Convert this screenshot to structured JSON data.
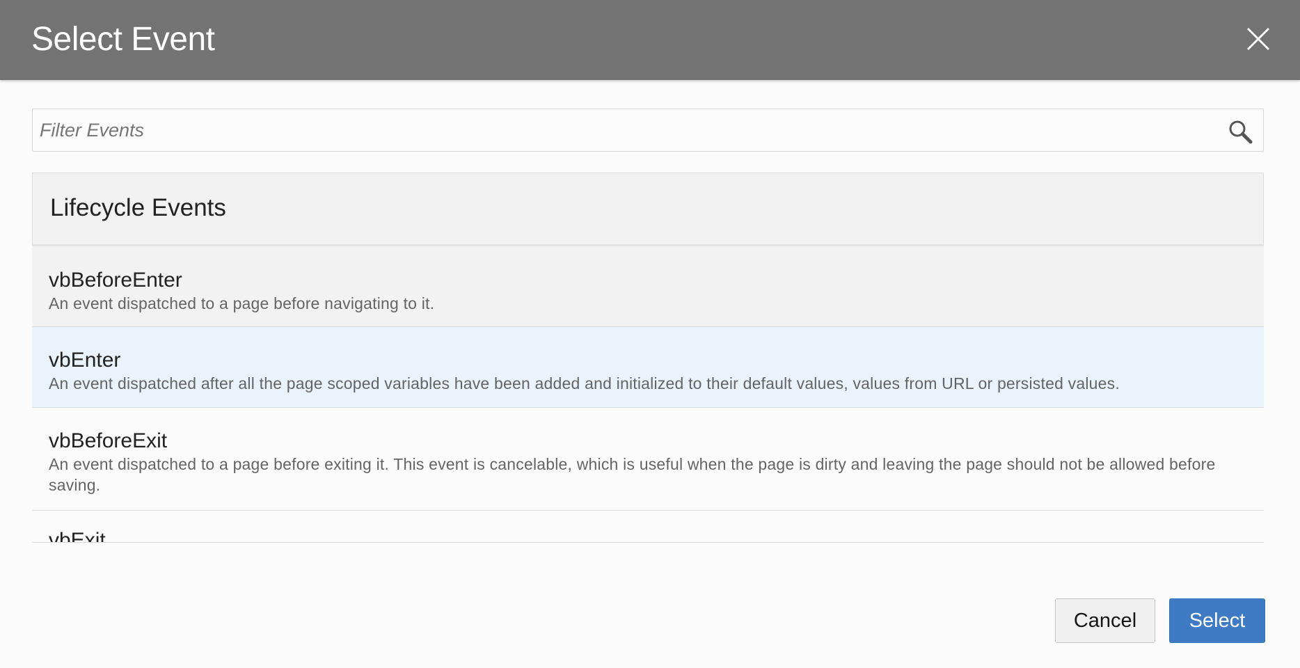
{
  "dialog": {
    "title": "Select Event",
    "close_icon": "close-icon"
  },
  "filter": {
    "placeholder": "Filter Events",
    "value": "",
    "icon": "search-icon"
  },
  "group": {
    "label": "Lifecycle Events"
  },
  "events": [
    {
      "name": "vbBeforeEnter",
      "description": "An event dispatched to a page before navigating to it."
    },
    {
      "name": "vbEnter",
      "description": "An event dispatched after all the page scoped variables have been added and initialized to their default values, values from URL or persisted values.",
      "selected": true
    },
    {
      "name": "vbBeforeExit",
      "description": "An event dispatched to a page before exiting it. This event is cancelable, which is useful when the page is dirty and leaving the page should not be allowed before saving."
    },
    {
      "name": "vbExit",
      "description": ""
    }
  ],
  "footer": {
    "cancel_label": "Cancel",
    "select_label": "Select"
  },
  "colors": {
    "header_bg": "#737373",
    "selected_row_bg": "#eaf2fb",
    "hover_row_bg": "#f2f2f2",
    "primary_button": "#3f7bc5"
  }
}
